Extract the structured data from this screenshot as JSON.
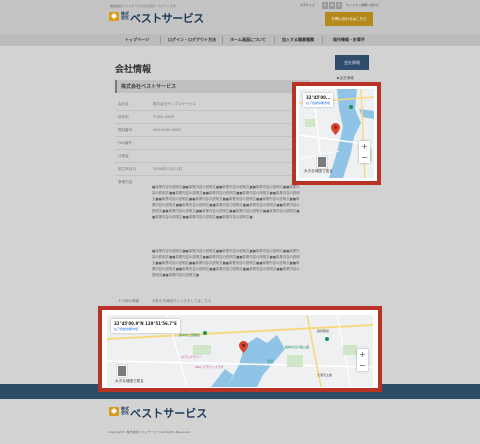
{
  "header": {
    "tagline": "株式会社ベストサービスの公式ホームページです",
    "logo_sub": "株式会社",
    "logo_name": "ベストサービス",
    "font_size_label": "文字サイズ",
    "font_sizes": [
      "小",
      "中",
      "大"
    ],
    "links": [
      "サイトマップ",
      "お問い合わせ"
    ],
    "contact_button": "お問い合わせはこちら"
  },
  "nav": [
    "トップページ",
    "ログイン・ログアウト方法",
    "ホーム画面について",
    "加入する職業種類",
    "操作情報・計算手"
  ],
  "main": {
    "title": "会社情報",
    "company_heading": "株式会社ベストサービス",
    "rows": [
      {
        "label": "会社名",
        "value": "株式会社サンプルサービス"
      },
      {
        "label": "所在地",
        "value": "〒000-0000"
      },
      {
        "label": "電話番号",
        "value": "000-0000-0000"
      },
      {
        "label": "FAX番号",
        "value": ""
      },
      {
        "label": "代表者",
        "value": ""
      },
      {
        "label": "設立年月日",
        "value": "2000年11月11日"
      },
      {
        "label": "事業内容",
        "value": ""
      }
    ],
    "dummy_block_1": "■事業内容の説明文■■事業内容の説明文■■事業内容の説明文■■事業内容の説明文■■事業内容の説明文■■事業内容の説明文■■事業内容の説明文■■事業内容の説明文■■事業内容の説明文■■事業内容の説明文■■事業内容の説明文■■事業内容の説明文■■事業内容の説明文■■事業内容の説明文■■事業内容の説明文■■事業内容の説明文■■事業内容の説明文■■事業内容の説明文■■事業内容の説明文■■事業内容の説明文■■事業内容の説明文■■事業内容の説明文■■事業内容の説明文■■事業内容の説明文■■事業内容の説明文■",
    "dummy_block_2": "■事業内容の説明文■■事業内容の説明文■■事業内容の説明文■■事業内容の説明文■■事業内容の説明文■■事業内容の説明文■■事業内容の説明文■■事業内容の説明文■■事業内容の説明文■■事業内容の説明文■■事業内容の説明文■■事業内容の説明文■■事業内容の説明文■■事業内容の説明文■■事業内容の説明文■■事業内容の説明文■■事業内容の説明文■■事業内容の説明文■■事業内容の説明文■",
    "after_label": "その他の情報",
    "after_value": "お取引先様紹介につきましてはこちら"
  },
  "sidebar": {
    "heading": "会社情報",
    "link": "▶会社情報"
  },
  "map_small": {
    "coord": "32°45'00...",
    "address": "右ア色前中都市場",
    "view_larger": "大きな地図で見る",
    "zoom_in": "+",
    "zoom_out": "−"
  },
  "map_large": {
    "coord": "32°45'00.9\"N 129°51'56.7\"E",
    "address": "右ア色前中都市場",
    "view_larger": "大きな地図で見る",
    "zoom_in": "+",
    "zoom_out": "−",
    "places": [
      "長崎市立図書館",
      "出島",
      "ホテルグラバー",
      "長崎駅前",
      "長崎水辺の森公園",
      "ANA クラウンプラザ",
      "大浦天主堂"
    ]
  },
  "footer": {
    "logo_sub": "株式会社",
    "logo_name": "ベストサービス",
    "copyright": "Copyright© 株式会社ベストサービス All Rights Reserved."
  },
  "colors": {
    "highlight_frame": "#b83325",
    "brand_navy": "#1d3a57",
    "accent_gold": "#b48a1c",
    "map_pin": "#d8452e"
  }
}
